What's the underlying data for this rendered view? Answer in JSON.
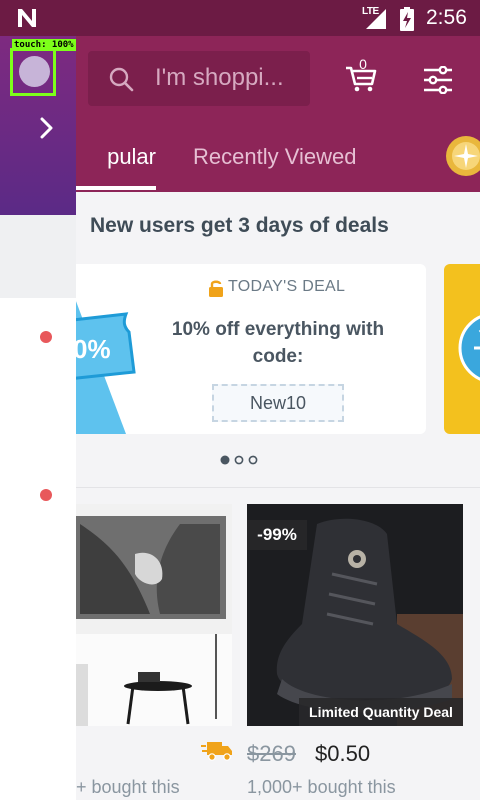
{
  "status_bar": {
    "network": "LTE",
    "time": "2:56"
  },
  "search": {
    "placeholder": "I'm shoppi..."
  },
  "cart": {
    "count": "0"
  },
  "tabs": [
    {
      "label": "pular",
      "active": true
    },
    {
      "label": "Recently Viewed",
      "active": false
    }
  ],
  "banner_title": "New users get 3 days of deals",
  "deal": {
    "label": "TODAY'S DEAL",
    "description": "10% off everything with code:",
    "code": "New10",
    "ticket_text": "0%"
  },
  "carousel": {
    "pages": 3,
    "active_page": 1
  },
  "products": [
    {
      "bought": "+ bought this"
    },
    {
      "discount": "-99%",
      "badge": "Limited Quantity Deal",
      "old_price": "$269",
      "price": "$0.50",
      "bought": "1,000+ bought this"
    }
  ],
  "overlay": {
    "touch_label": "touch: 100%"
  },
  "colors": {
    "status_bar": "#6c1b44",
    "header": "#8d2558",
    "panel": "#5b2a86",
    "touch": "#7dff1a",
    "dot": "#e8585b",
    "deal_yellow": "#f3c11e"
  },
  "icons": [
    "n-logo-icon",
    "signal-icon",
    "battery-icon",
    "search-icon",
    "cart-icon",
    "filter-icon",
    "coin-icon",
    "lock-icon",
    "truck-icon",
    "chevron-right-icon"
  ]
}
